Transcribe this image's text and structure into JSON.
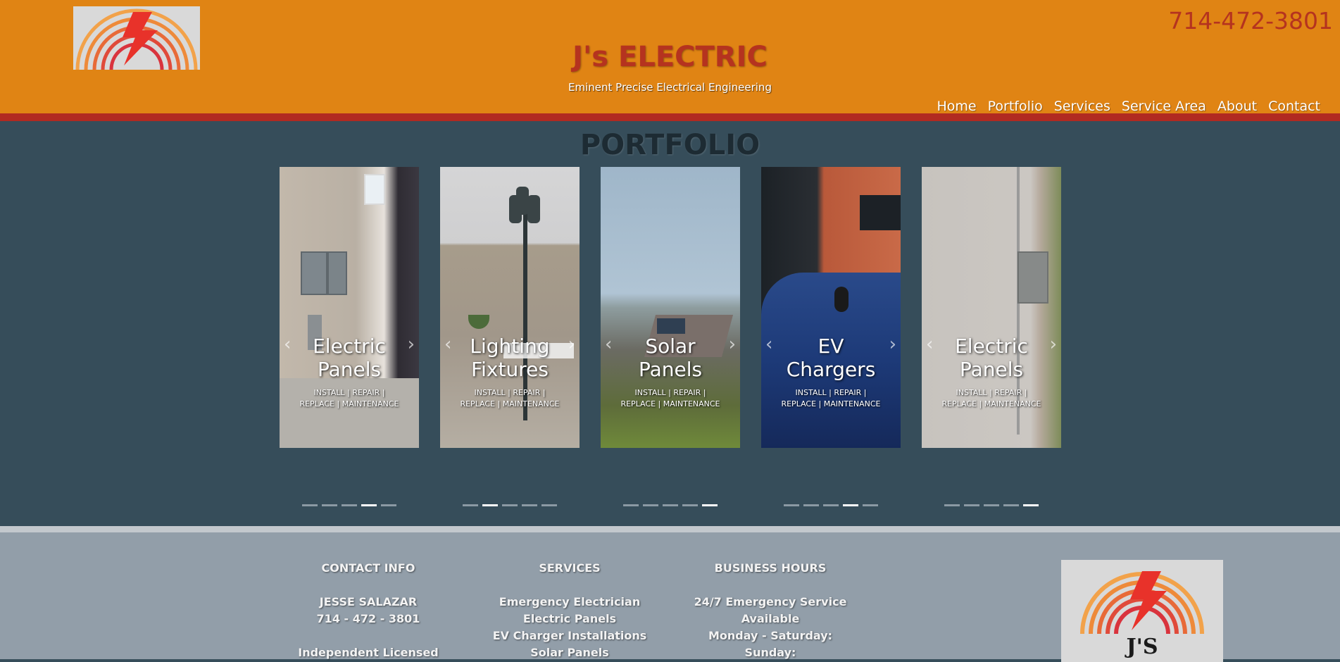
{
  "header": {
    "brand": "J's ELECTRIC",
    "tagline": "Eminent Precise Electrical Engineering",
    "phone": "714-472-3801",
    "logo_icon": "lightning-rainbow-logo"
  },
  "nav": {
    "items": [
      {
        "label": "Home"
      },
      {
        "label": "Portfolio"
      },
      {
        "label": "Services"
      },
      {
        "label": "Service Area"
      },
      {
        "label": "About"
      },
      {
        "label": "Contact"
      }
    ]
  },
  "portfolio": {
    "title": "PORTFOLIO",
    "cards": [
      {
        "title_line1": "Electric",
        "title_line2": "Panels",
        "subtitle": "INSTALL | REPAIR | REPLACE | MAINTENANCE",
        "slide_count": 5,
        "active_slide": 4
      },
      {
        "title_line1": "Lighting",
        "title_line2": "Fixtures",
        "subtitle": "INSTALL | REPAIR | REPLACE | MAINTENANCE",
        "slide_count": 5,
        "active_slide": 2
      },
      {
        "title_line1": "Solar",
        "title_line2": "Panels",
        "subtitle": "INSTALL | REPAIR | REPLACE | MAINTENANCE",
        "slide_count": 5,
        "active_slide": 5
      },
      {
        "title_line1": "EV",
        "title_line2": "Chargers",
        "subtitle": "INSTALL | REPAIR | REPLACE | MAINTENANCE",
        "slide_count": 5,
        "active_slide": 4
      },
      {
        "title_line1": "Electric",
        "title_line2": "Panels",
        "subtitle": "INSTALL | REPAIR | REPLACE | MAINTENANCE",
        "slide_count": 5,
        "active_slide": 5
      }
    ]
  },
  "footer": {
    "contact": {
      "heading": "CONTACT INFO",
      "name": "JESSE SALAZAR",
      "phone": "714 - 472 - 3801",
      "license": "Independent Licensed"
    },
    "services": {
      "heading": "SERVICES",
      "items": [
        "Emergency Electrician",
        "Electric Panels",
        "EV Charger Installations",
        "Solar Panels"
      ]
    },
    "hours": {
      "heading": "BUSINESS HOURS",
      "line1": "24/7 Emergency Service",
      "line2": "Available",
      "line3": "Monday - Saturday:",
      "line4": "Sunday:"
    },
    "logo_text": "J'S ELECTRIC"
  }
}
